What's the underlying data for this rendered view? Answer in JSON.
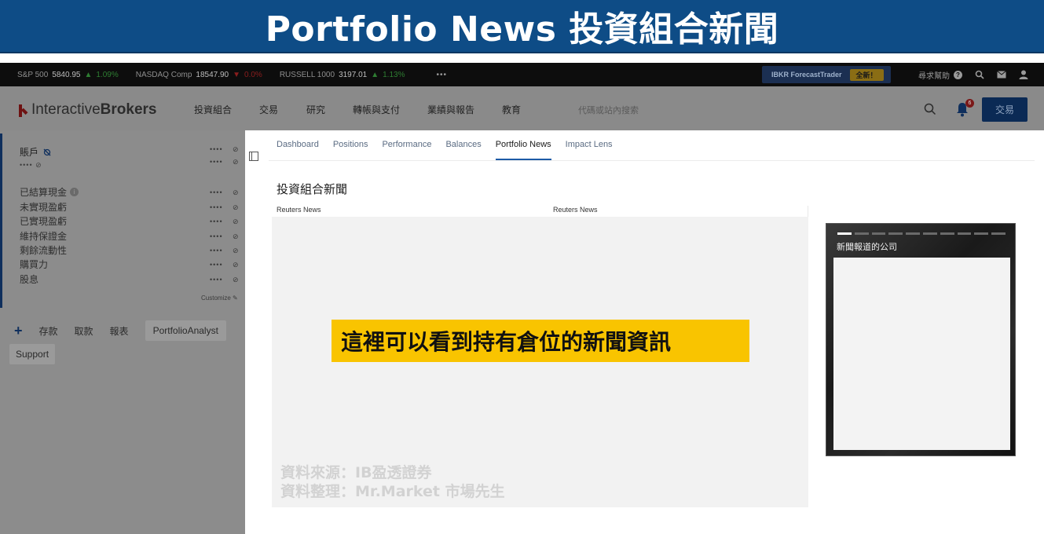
{
  "banner": {
    "title": "Portfolio News 投資組合新聞"
  },
  "ticker": {
    "items": [
      {
        "name": "S&P 500",
        "value": "5840.95",
        "arrow": "▲",
        "change": "1.09%",
        "dir": "up"
      },
      {
        "name": "NASDAQ Comp",
        "value": "18547.90",
        "arrow": "▼",
        "change": "0.0%",
        "dir": "down"
      },
      {
        "name": "RUSSELL 1000",
        "value": "3197.01",
        "arrow": "▲",
        "change": "1.13%",
        "dir": "up"
      }
    ],
    "more": "•••",
    "promo_label": "IBKR ForecastTrader",
    "promo_badge": "全新！",
    "help_label": "尋求幫助",
    "help_symbol": "?"
  },
  "header": {
    "logo_light": "Interactive",
    "logo_bold": "Brokers",
    "nav": [
      "投資組合",
      "交易",
      "研究",
      "轉帳與支付",
      "業績與報告",
      "教育"
    ],
    "search_placeholder": "代碼或站內搜索",
    "notification_count": "6",
    "trade_button": "交易"
  },
  "sidebar": {
    "account_title": "賬戶",
    "account_sub": "••••",
    "masked": "••••",
    "metrics": [
      "已結算現金",
      "未實現盈虧",
      "已實現盈虧",
      "維持保證金",
      "剩餘流動性",
      "購買力",
      "股息"
    ],
    "customize": "Customize",
    "actions": [
      "存款",
      "取款",
      "報表",
      "PortfolioAnalyst"
    ],
    "support": "Support"
  },
  "main": {
    "tabs": [
      "Dashboard",
      "Positions",
      "Performance",
      "Balances",
      "Portfolio News",
      "Impact Lens"
    ],
    "active_tab": "Portfolio News",
    "title": "投資組合新聞",
    "col1": "Reuters News",
    "col2": "Reuters News"
  },
  "annotation": {
    "note": "這裡可以看到持有倉位的新聞資訊",
    "credit1": "資料來源：IB盈透證券",
    "credit2": "資料整理：Mr.Market 市場先生"
  },
  "media": {
    "label": "新聞報道的公司"
  }
}
